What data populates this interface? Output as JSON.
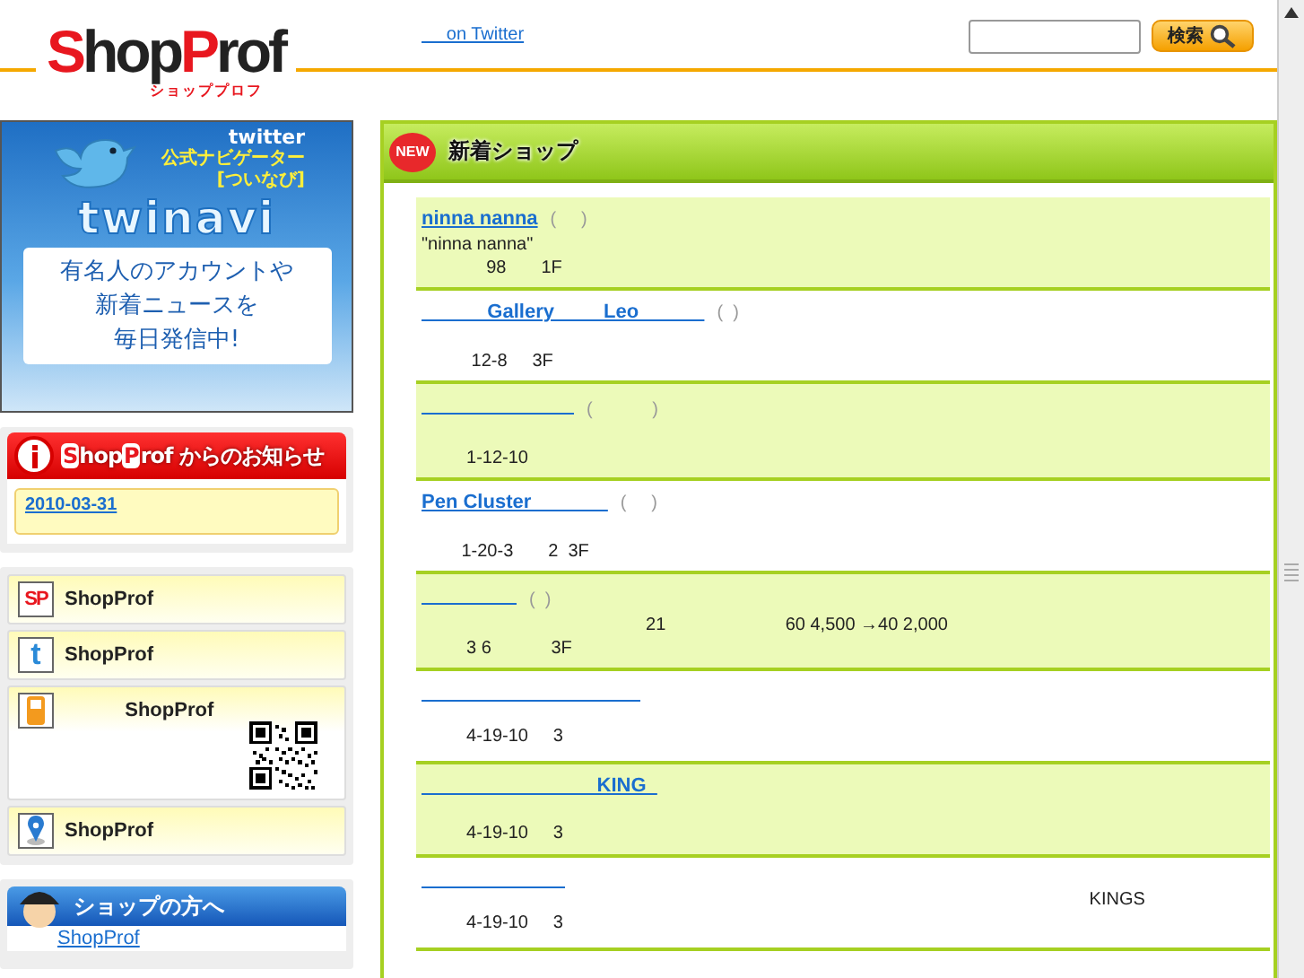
{
  "header": {
    "logo": [
      {
        "text": "S",
        "accent": true
      },
      {
        "text": "hop",
        "accent": false
      },
      {
        "text": "P",
        "accent": true
      },
      {
        "text": "rof",
        "accent": false
      }
    ],
    "logo_sub": "ショッププロフ",
    "twitter_link": "     on Twitter",
    "search": {
      "button": "検索"
    }
  },
  "banner": {
    "brand": "twitter",
    "title": "公式ナビゲーター",
    "subtitle": "[ついなび]",
    "logo": "twinavi",
    "message": [
      "有名人のアカウントや",
      "新着ニュースを",
      "毎日発信中!"
    ]
  },
  "notice": {
    "title": [
      {
        "text": "S",
        "accent": true
      },
      {
        "text": "hop",
        "accent": false
      },
      {
        "text": "P",
        "accent": true
      },
      {
        "text": "rof",
        "accent": false
      }
    ],
    "title_rest": " からのお知らせ",
    "date": "2010-03-31"
  },
  "links": [
    {
      "kind": "sp",
      "icon_text": "SP",
      "label": "ShopProf"
    },
    {
      "kind": "twitter",
      "icon_text": "t",
      "label": "ShopProf"
    },
    {
      "kind": "mobile",
      "label": "           ShopProf"
    },
    {
      "kind": "map",
      "label": "ShopProf"
    }
  ],
  "shop_owners": {
    "title": "ショップの方へ",
    "items": [
      "ShopProf"
    ]
  },
  "main": {
    "badge": "NEW",
    "title": "新着ショップ",
    "shops": [
      {
        "name": "ninna nanna",
        "paren": "(     )",
        "lines": [
          "\"ninna nanna\"",
          "             98       1F"
        ]
      },
      {
        "name": "            Gallery         Leo            ",
        "paren": "(  )",
        "lines": [
          "          12-8     3F"
        ]
      },
      {
        "paren": "(            )",
        "lines": [
          "         1-12-10"
        ]
      },
      {
        "name": "Pen Cluster              ",
        "paren": "(     )",
        "lines": [
          "        1-20-3       2  3F"
        ]
      },
      {
        "paren": "(  )",
        "lines": [
          "                                             21                        60 4,500 →40 2,000",
          "         3 6            3F"
        ]
      },
      {
        "lines": [
          "         4-19-10     3"
        ]
      },
      {
        "name": "                                KING  ",
        "lines": [
          "         4-19-10     3"
        ]
      },
      {
        "lines": [
          "                                                                                                                                      KINGS",
          "         4-19-10     3"
        ]
      }
    ]
  }
}
